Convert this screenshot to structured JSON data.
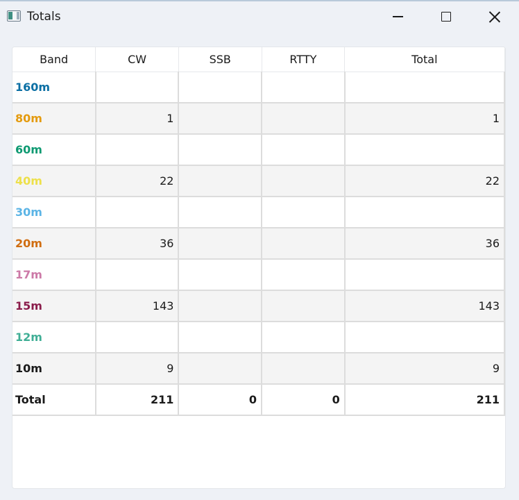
{
  "window": {
    "title": "Totals"
  },
  "colors": {
    "160m": "#0b6fa4",
    "80m": "#e49b0f",
    "60m": "#0e9a72",
    "40m": "#ede04a",
    "30m": "#5bb4e5",
    "20m": "#d06d10",
    "17m": "#cc79a7",
    "15m": "#8a1d4b",
    "12m": "#3fae95",
    "10m": "#1a1a1a"
  },
  "table": {
    "headers": [
      "Band",
      "CW",
      "SSB",
      "RTTY",
      "Total"
    ],
    "rows": [
      {
        "band": "160m",
        "cw": "",
        "ssb": "",
        "rtty": "",
        "total": ""
      },
      {
        "band": "80m",
        "cw": "1",
        "ssb": "",
        "rtty": "",
        "total": "1"
      },
      {
        "band": "60m",
        "cw": "",
        "ssb": "",
        "rtty": "",
        "total": ""
      },
      {
        "band": "40m",
        "cw": "22",
        "ssb": "",
        "rtty": "",
        "total": "22"
      },
      {
        "band": "30m",
        "cw": "",
        "ssb": "",
        "rtty": "",
        "total": ""
      },
      {
        "band": "20m",
        "cw": "36",
        "ssb": "",
        "rtty": "",
        "total": "36"
      },
      {
        "band": "17m",
        "cw": "",
        "ssb": "",
        "rtty": "",
        "total": ""
      },
      {
        "band": "15m",
        "cw": "143",
        "ssb": "",
        "rtty": "",
        "total": "143"
      },
      {
        "band": "12m",
        "cw": "",
        "ssb": "",
        "rtty": "",
        "total": ""
      },
      {
        "band": "10m",
        "cw": "9",
        "ssb": "",
        "rtty": "",
        "total": "9"
      }
    ],
    "total_row": {
      "band": "Total",
      "cw": "211",
      "ssb": "0",
      "rtty": "0",
      "total": "211"
    }
  }
}
